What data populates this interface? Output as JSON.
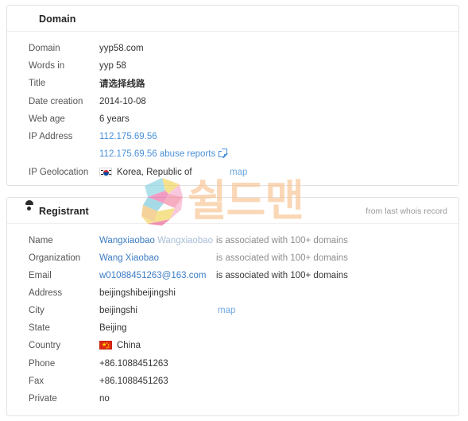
{
  "domain_card": {
    "icon": "globe-icon",
    "title": "Domain",
    "rows": [
      {
        "label": "Domain",
        "value": "yyp58.com",
        "type": "text"
      },
      {
        "label": "Words in",
        "value": "yyp 58",
        "type": "text"
      },
      {
        "label": "Title",
        "value": "请选择线路",
        "type": "cjk-bold"
      },
      {
        "label": "Date creation",
        "value": "2014-10-08",
        "type": "text"
      },
      {
        "label": "Web age",
        "value": "6 years",
        "type": "text"
      },
      {
        "label": "IP Address",
        "value": "112.175.69.56",
        "type": "link"
      },
      {
        "label": "",
        "value": "112.175.69.56 abuse reports",
        "type": "link-external"
      },
      {
        "label": "IP Geolocation",
        "value": "Korea, Republic of",
        "type": "flag-kr",
        "map_label": "map"
      }
    ]
  },
  "registrant_card": {
    "icon": "person-icon",
    "title": "Registrant",
    "note": "from last whois record",
    "rows": [
      {
        "label": "Name",
        "value": "Wangxiaobao",
        "value_secondary": "Wangxiaobao",
        "assoc": "is associated with 100+ domains",
        "assoc_style": "grey",
        "type": "link-dual"
      },
      {
        "label": "Organization",
        "value": "Wang Xiaobao",
        "assoc": "is associated with 100+ domains",
        "assoc_style": "grey",
        "type": "link"
      },
      {
        "label": "Email",
        "value": "w01088451263@163.com",
        "assoc": "is associated with 100+ domains",
        "assoc_style": "dark",
        "type": "link"
      },
      {
        "label": "Address",
        "value": "beijingshibeijingshi",
        "type": "text"
      },
      {
        "label": "City",
        "value": "beijingshi",
        "map_label": "map",
        "type": "text-map"
      },
      {
        "label": "State",
        "value": "Beijing",
        "type": "text"
      },
      {
        "label": "Country",
        "value": "China",
        "type": "flag-cn"
      },
      {
        "label": "Phone",
        "value": "+86.1088451263",
        "type": "text"
      },
      {
        "label": "Fax",
        "value": "+86.1088451263",
        "type": "text"
      },
      {
        "label": "Private",
        "value": "no",
        "type": "text"
      }
    ]
  },
  "watermark": {
    "text": "쉴드맨",
    "logo": "shield-s-logo",
    "color": "#f7bf8a"
  },
  "colors": {
    "link": "#4a90d9",
    "link_dark": "#3b7cc4",
    "link_faded": "#a8bed6",
    "map_link": "#6ea8dd",
    "label": "#555555",
    "value": "#333333",
    "note": "#9a9a9a",
    "card_border": "#e2e2e2"
  }
}
